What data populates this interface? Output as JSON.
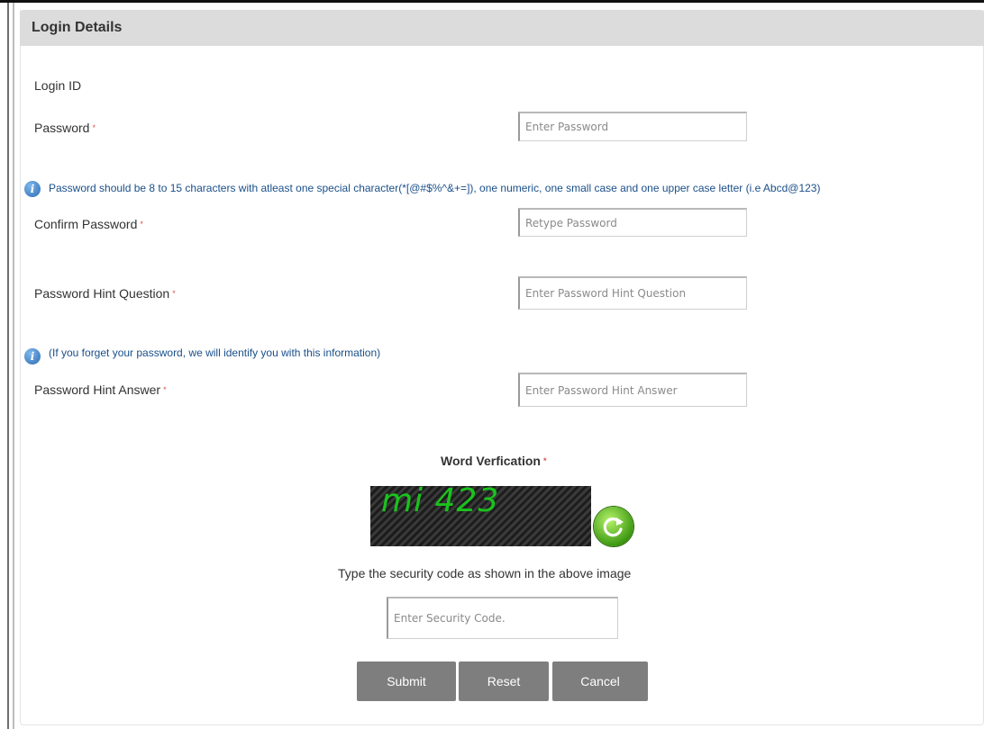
{
  "panel": {
    "title": "Login Details"
  },
  "form": {
    "login_id_label": "Login ID",
    "password_label": "Password",
    "password_placeholder": "Enter Password",
    "password_info": "Password should be 8 to 15 characters with atleast one special character(*[@#$%^&+=]), one numeric, one small case and one upper case letter (i.e Abcd@123)",
    "confirm_label": "Confirm Password",
    "confirm_placeholder": "Retype Password",
    "hint_q_label": "Password Hint Question",
    "hint_q_placeholder": "Enter Password Hint Question",
    "hint_info": "(If you forget your password, we will identify you with this information)",
    "hint_a_label": "Password Hint Answer",
    "hint_a_placeholder": "Enter Password Hint Answer",
    "required_mark": "*"
  },
  "captcha": {
    "title": "Word Verfication",
    "code": "mi 423",
    "instruction": "Type the security code as shown in the above image",
    "input_placeholder": "Enter Security Code."
  },
  "buttons": {
    "submit": "Submit",
    "reset": "Reset",
    "cancel": "Cancel"
  },
  "icons": {
    "info": "info-icon",
    "refresh": "refresh-icon"
  },
  "colors": {
    "header_bg": "#dcdcdc",
    "required": "#d9534f",
    "info_text": "#1a4f8a",
    "button_bg": "#7e7e7e",
    "captcha_text": "#19c31c"
  }
}
